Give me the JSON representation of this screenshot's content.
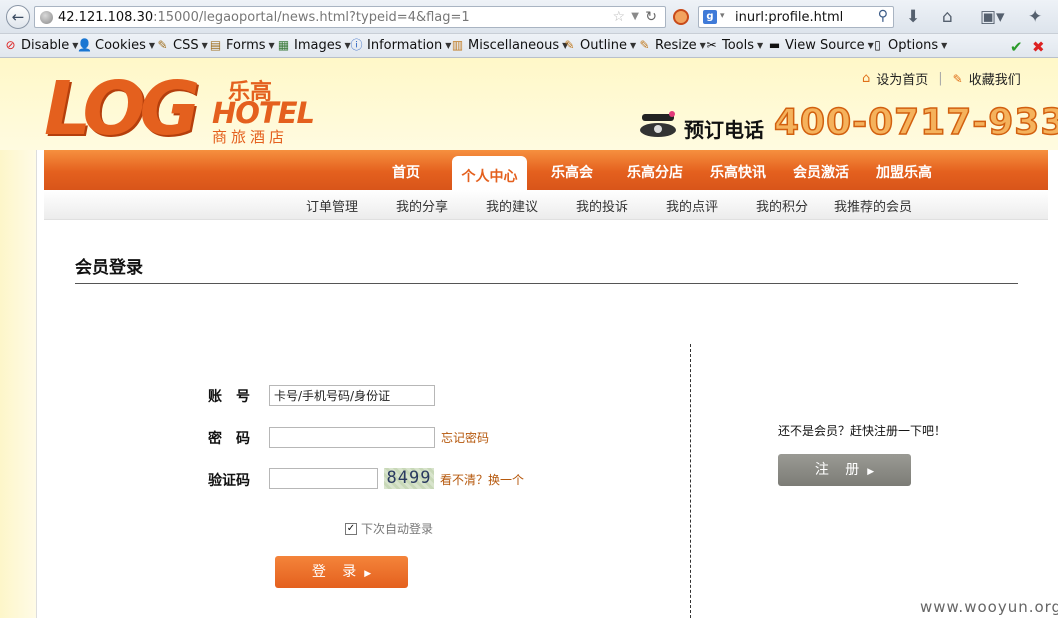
{
  "browser": {
    "url_host": "42.121.108.30",
    "url_rest": ":15000/legaoportal/news.html?typeid=4&flag=1",
    "search_text": "inurl:profile.html",
    "search_engine_letter": "g"
  },
  "devbar": {
    "items": [
      "Disable",
      "Cookies",
      "CSS",
      "Forms",
      "Images",
      "Information",
      "Miscellaneous",
      "Outline",
      "Resize",
      "Tools",
      "View Source",
      "Options"
    ]
  },
  "logo": {
    "log": "LOG",
    "cn_top": "乐高",
    "hotel": "HOTEL",
    "cn_bottom": "商旅酒店"
  },
  "top_links": {
    "set_home": "设为首页",
    "favorite": "收藏我们"
  },
  "phone": {
    "label": "预订电话",
    "number": "400-0717-933"
  },
  "nav": {
    "items": [
      "首页",
      "个人中心",
      "乐高会",
      "乐高分店",
      "乐高快讯",
      "会员激活",
      "加盟乐高"
    ]
  },
  "subnav": {
    "items": [
      "订单管理",
      "我的分享",
      "我的建议",
      "我的投诉",
      "我的点评",
      "我的积分",
      "我推荐的会员"
    ]
  },
  "login": {
    "title": "会员登录",
    "account_label": "账　号",
    "account_value": "卡号/手机号码/身份证",
    "password_label": "密　码",
    "forgot_password": "忘记密码",
    "captcha_label": "验证码",
    "captcha_code": "8499",
    "captcha_refresh": "看不清？换一个",
    "remember_label": "下次自动登录",
    "remember_checked": true,
    "login_button": "登 录"
  },
  "register": {
    "prompt": "还不是会员？赶快注册一下吧！",
    "button": "注 册"
  },
  "watermark": "www.wooyun.org",
  "colors": {
    "brand_orange": "#e4601e",
    "link_brown": "#b5570b",
    "register_gray": "#8a8a84"
  }
}
